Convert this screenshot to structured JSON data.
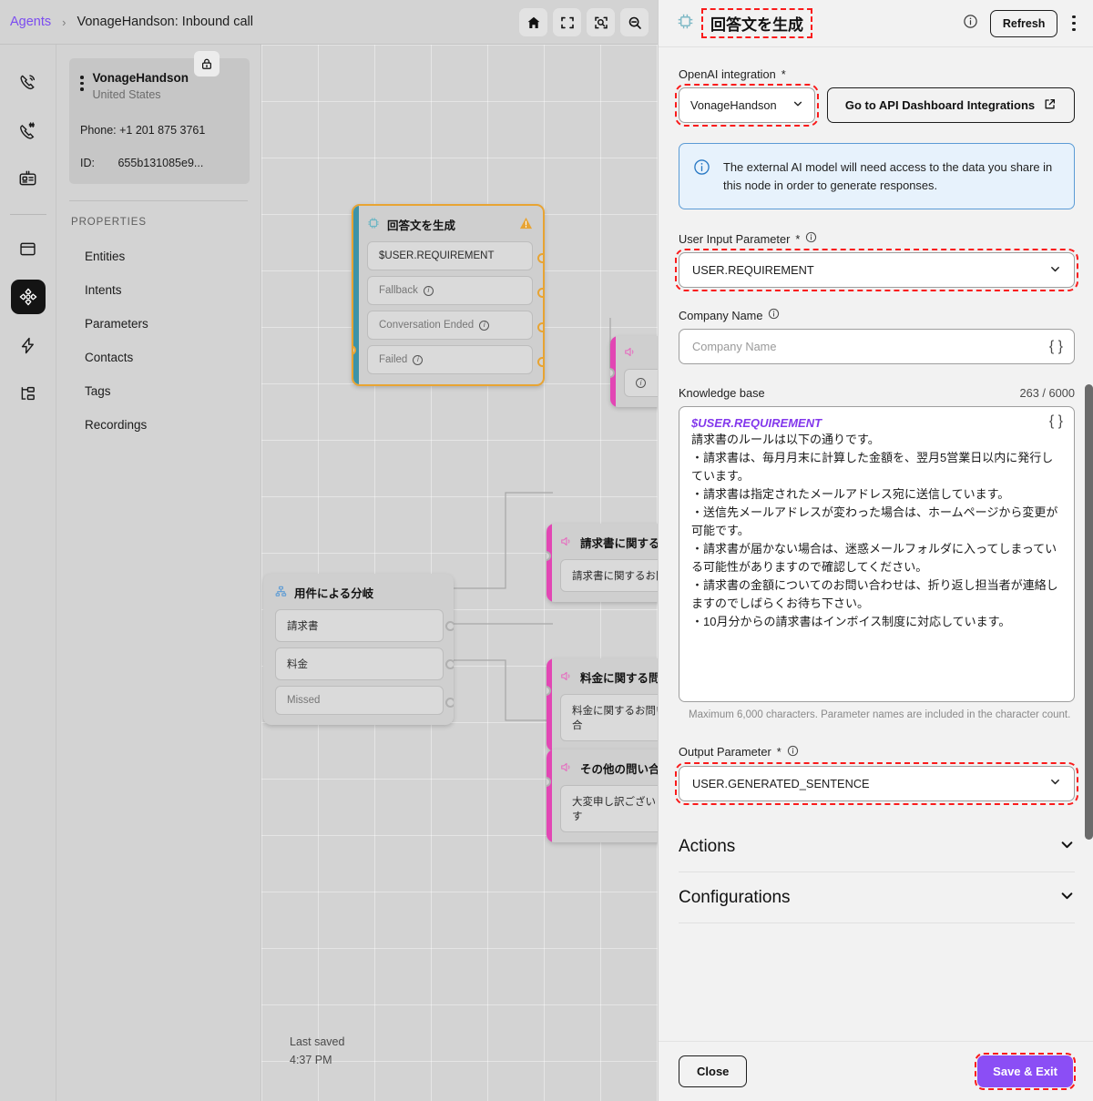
{
  "breadcrumb": {
    "root": "Agents",
    "separator": "›",
    "current": "VonageHandson: Inbound call"
  },
  "canvas_toolbar": [
    {
      "name": "home-icon",
      "label": "Home"
    },
    {
      "name": "fit-screen-icon",
      "label": "Fit to screen"
    },
    {
      "name": "zoom-to-selection-icon",
      "label": "Zoom to selection"
    },
    {
      "name": "zoom-out-icon",
      "label": "Zoom out"
    }
  ],
  "rail": [
    {
      "name": "calls-icon",
      "label": "Calls",
      "active": false
    },
    {
      "name": "numbers-icon",
      "label": "Numbers",
      "active": false
    },
    {
      "name": "contact-card-icon",
      "label": "Contacts",
      "active": false
    },
    {
      "name": "layout-icon",
      "label": "Layout",
      "active": false
    },
    {
      "name": "flow-builder-icon",
      "label": "Flow builder",
      "active": true
    },
    {
      "name": "events-icon",
      "label": "Events",
      "active": false
    },
    {
      "name": "hierarchy-icon",
      "label": "Hierarchy",
      "active": false
    }
  ],
  "agent_card": {
    "name": "VonageHandson",
    "country": "United States",
    "phone_label": "Phone:",
    "phone_value": "+1 201 875 3761",
    "id_label": "ID:",
    "id_value": "655b131085e9..."
  },
  "properties": {
    "heading": "PROPERTIES",
    "items": [
      {
        "label": "Entities"
      },
      {
        "label": "Intents"
      },
      {
        "label": "Parameters"
      },
      {
        "label": "Contacts"
      },
      {
        "label": "Tags"
      },
      {
        "label": "Recordings"
      }
    ]
  },
  "canvas": {
    "last_saved_label": "Last saved",
    "last_saved_time": "4:37 PM",
    "nodes": [
      {
        "title": "回答文を生成",
        "icon": "ai-chip-icon",
        "selected": true,
        "warning": true,
        "stripe": "#3d93a8",
        "rows": [
          {
            "label": "$USER.REQUIREMENT",
            "muted": false,
            "info": false
          },
          {
            "label": "Fallback",
            "muted": true,
            "info": true
          },
          {
            "label": "Conversation Ended",
            "muted": true,
            "info": true
          },
          {
            "label": "Failed",
            "muted": true,
            "info": true
          }
        ]
      },
      {
        "title": "用件による分岐",
        "icon": "branch-icon",
        "selected": false,
        "warning": false,
        "stripe": "",
        "rows": [
          {
            "label": "請求書",
            "muted": false,
            "info": false
          },
          {
            "label": "料金",
            "muted": false,
            "info": false
          },
          {
            "label": "Missed",
            "muted": true,
            "info": false
          }
        ]
      },
      {
        "title": "請求書に関する問",
        "icon": "speaker-icon",
        "selected": false,
        "warning": false,
        "stripe": "#e246b4",
        "rows": [
          {
            "label": "請求書に関するお問",
            "muted": false,
            "info": false
          }
        ]
      },
      {
        "title": "料金に関する問い",
        "icon": "speaker-icon",
        "selected": false,
        "warning": false,
        "stripe": "#e246b4",
        "rows": [
          {
            "label": "料金に関するお問い合",
            "muted": false,
            "info": false
          }
        ]
      },
      {
        "title": "その他の問い合わ",
        "icon": "speaker-icon",
        "selected": false,
        "warning": false,
        "stripe": "#e246b4",
        "rows": [
          {
            "label": "大変申し訳ございます",
            "muted": false,
            "info": false
          }
        ]
      }
    ]
  },
  "panel": {
    "title": "回答文を生成",
    "title_icon": "ai-chip-icon",
    "info_icon": "info-icon",
    "refresh_label": "Refresh",
    "more_icon": "kebab-menu-icon",
    "integration": {
      "label": "OpenAI integration",
      "required_mark": "*",
      "selected": "VonageHandson",
      "dashboard_button": "Go to API Dashboard Integrations",
      "external_icon": "external-link-icon"
    },
    "notice": {
      "icon": "info-circle-icon",
      "text": "The external AI model will need access to the data you share in this node in order to generate responses."
    },
    "user_input": {
      "label": "User Input Parameter",
      "required_mark": "*",
      "value": "USER.REQUIREMENT"
    },
    "company_name": {
      "label": "Company Name",
      "value": "",
      "placeholder": "Company Name",
      "braces_icon": "curly-braces-icon"
    },
    "knowledge_base": {
      "label": "Knowledge base",
      "counter": "263 / 6000",
      "variable": "$USER.REQUIREMENT",
      "body": "請求書のルールは以下の通りです。\n・請求書は、毎月月末に計算した金額を、翌月5営業日以内に発行しています。\n・請求書は指定されたメールアドレス宛に送信しています。\n・送信先メールアドレスが変わった場合は、ホームページから変更が可能です。\n・請求書が届かない場合は、迷惑メールフォルダに入ってしまっている可能性がありますので確認してください。\n・請求書の金額についてのお問い合わせは、折り返し担当者が連絡しますのでしばらくお待ち下さい。\n・10月分からの請求書はインボイス制度に対応しています。",
      "hint": "Maximum 6,000 characters. Parameter names are included in the character count.",
      "braces_icon": "curly-braces-icon"
    },
    "output_parameter": {
      "label": "Output Parameter",
      "required_mark": "*",
      "value": "USER.GENERATED_SENTENCE"
    },
    "sections": [
      {
        "label": "Actions",
        "icon": "chevron-down-icon"
      },
      {
        "label": "Configurations",
        "icon": "chevron-down-icon"
      }
    ],
    "footer": {
      "close_label": "Close",
      "save_label": "Save & Exit"
    }
  },
  "colors": {
    "accent_purple": "#8b4ef5",
    "link_purple": "#7b4cf0",
    "selected_node_border": "#e8a433",
    "pink_stripe": "#e246b4",
    "teal_stripe": "#3d93a8",
    "notice_bg": "#e7f2fc",
    "notice_border": "#5b9bd5",
    "highlight_red": "#fa1b1b",
    "variable_purple": "#8338ec"
  }
}
